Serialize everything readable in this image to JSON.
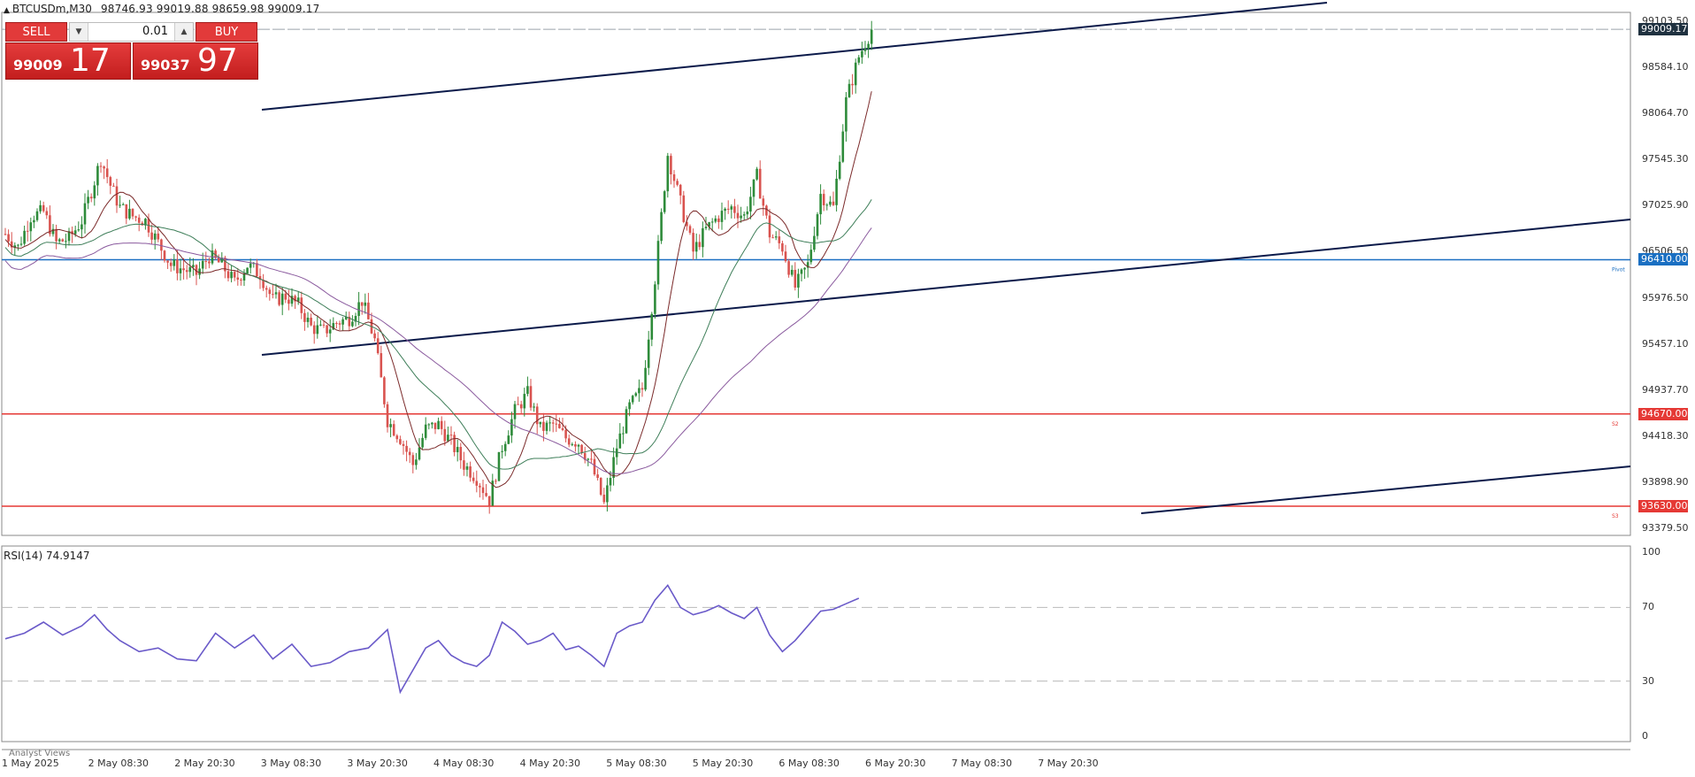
{
  "symbol": {
    "name": "BTCUSDm,M30",
    "ohlc": "98746.93 99019.88 98659.98 99009.17"
  },
  "trade_panel": {
    "sell_label": "SELL",
    "buy_label": "BUY",
    "lot": "0.01",
    "bid_main": "99009",
    "bid_big": "17",
    "ask_main": "99037",
    "ask_big": "97"
  },
  "price_axis": [
    "99103.50",
    "98584.10",
    "98064.70",
    "97545.30",
    "97025.90",
    "96506.50",
    "95976.50",
    "95457.10",
    "94937.70",
    "94418.30",
    "93898.90",
    "93379.50"
  ],
  "price_tags": {
    "current": "99009.17",
    "pivot": "96410.00",
    "s2": "94670.00",
    "s3": "93630.00"
  },
  "line_labels": {
    "pivot": "Pivot",
    "s2": "S2",
    "s3": "S3"
  },
  "rsi": {
    "label": "RSI(14) 74.9147",
    "levels": [
      "100",
      "70",
      "30",
      "0"
    ]
  },
  "time_axis": [
    "1 May 2025",
    "2 May 08:30",
    "2 May 20:30",
    "3 May 08:30",
    "3 May 20:30",
    "4 May 08:30",
    "4 May 20:30",
    "5 May 08:30",
    "5 May 20:30",
    "6 May 08:30",
    "6 May 20:30",
    "7 May 08:30",
    "7 May 20:30"
  ],
  "bottom_tab": "Analyst Views",
  "colors": {
    "bull": "#2e8b3a",
    "bear": "#d9534f",
    "pivot_line": "#1a6fc2",
    "support_line": "#e53935",
    "trend_line": "#0b1a4a",
    "rsi_line": "#6a5ac9",
    "ma_fast": "#7b2a2a",
    "ma_mid": "#3f7f5a",
    "ma_slow": "#8a5a9e"
  },
  "chart_data": {
    "type": "candlestick",
    "timeframe": "M30",
    "ylim": [
      93300,
      99200
    ],
    "rsi_levels": [
      70,
      30
    ],
    "key_levels": {
      "pivot": 96410.0,
      "s2": 94670.0,
      "s3": 93630.0,
      "last": 99009.17
    },
    "price_path": [
      [
        0,
        96700
      ],
      [
        4,
        96550
      ],
      [
        8,
        96900
      ],
      [
        12,
        96950
      ],
      [
        16,
        96600
      ],
      [
        20,
        96650
      ],
      [
        24,
        96850
      ],
      [
        28,
        97300
      ],
      [
        30,
        97550
      ],
      [
        33,
        97250
      ],
      [
        36,
        97000
      ],
      [
        40,
        96900
      ],
      [
        44,
        96850
      ],
      [
        48,
        96600
      ],
      [
        52,
        96350
      ],
      [
        56,
        96300
      ],
      [
        60,
        96250
      ],
      [
        64,
        96450
      ],
      [
        68,
        96350
      ],
      [
        72,
        96150
      ],
      [
        76,
        96350
      ],
      [
        80,
        96250
      ],
      [
        84,
        95950
      ],
      [
        88,
        96000
      ],
      [
        92,
        95900
      ],
      [
        96,
        95650
      ],
      [
        100,
        95600
      ],
      [
        104,
        95700
      ],
      [
        108,
        95750
      ],
      [
        112,
        95950
      ],
      [
        116,
        95500
      ],
      [
        120,
        94600
      ],
      [
        124,
        94400
      ],
      [
        128,
        94100
      ],
      [
        132,
        94500
      ],
      [
        136,
        94550
      ],
      [
        140,
        94350
      ],
      [
        144,
        94100
      ],
      [
        148,
        93950
      ],
      [
        152,
        93700
      ],
      [
        156,
        94300
      ],
      [
        160,
        94700
      ],
      [
        164,
        94900
      ],
      [
        168,
        94500
      ],
      [
        172,
        94550
      ],
      [
        176,
        94400
      ],
      [
        180,
        94350
      ],
      [
        184,
        94100
      ],
      [
        188,
        93650
      ],
      [
        192,
        94300
      ],
      [
        196,
        94750
      ],
      [
        200,
        94950
      ],
      [
        204,
        96200
      ],
      [
        208,
        97600
      ],
      [
        212,
        97050
      ],
      [
        216,
        96500
      ],
      [
        220,
        96750
      ],
      [
        224,
        96900
      ],
      [
        228,
        97000
      ],
      [
        232,
        96900
      ],
      [
        236,
        97350
      ],
      [
        240,
        96700
      ],
      [
        244,
        96550
      ],
      [
        248,
        96100
      ],
      [
        252,
        96350
      ],
      [
        256,
        97150
      ],
      [
        260,
        97000
      ],
      [
        264,
        98200
      ],
      [
        268,
        98700
      ],
      [
        272,
        99009
      ]
    ],
    "rsi_path": [
      [
        0,
        53
      ],
      [
        6,
        56
      ],
      [
        12,
        62
      ],
      [
        18,
        55
      ],
      [
        24,
        60
      ],
      [
        28,
        66
      ],
      [
        32,
        58
      ],
      [
        36,
        52
      ],
      [
        42,
        46
      ],
      [
        48,
        48
      ],
      [
        54,
        42
      ],
      [
        60,
        41
      ],
      [
        66,
        56
      ],
      [
        72,
        48
      ],
      [
        78,
        55
      ],
      [
        84,
        42
      ],
      [
        90,
        50
      ],
      [
        96,
        38
      ],
      [
        102,
        40
      ],
      [
        108,
        46
      ],
      [
        114,
        48
      ],
      [
        120,
        58
      ],
      [
        124,
        24
      ],
      [
        128,
        36
      ],
      [
        132,
        48
      ],
      [
        136,
        52
      ],
      [
        140,
        44
      ],
      [
        144,
        40
      ],
      [
        148,
        38
      ],
      [
        152,
        44
      ],
      [
        156,
        62
      ],
      [
        160,
        57
      ],
      [
        164,
        50
      ],
      [
        168,
        52
      ],
      [
        172,
        56
      ],
      [
        176,
        47
      ],
      [
        180,
        49
      ],
      [
        184,
        44
      ],
      [
        188,
        38
      ],
      [
        192,
        56
      ],
      [
        196,
        60
      ],
      [
        200,
        62
      ],
      [
        204,
        74
      ],
      [
        208,
        82
      ],
      [
        212,
        70
      ],
      [
        216,
        66
      ],
      [
        220,
        68
      ],
      [
        224,
        71
      ],
      [
        228,
        67
      ],
      [
        232,
        64
      ],
      [
        236,
        70
      ],
      [
        240,
        55
      ],
      [
        244,
        46
      ],
      [
        248,
        52
      ],
      [
        252,
        60
      ],
      [
        256,
        68
      ],
      [
        260,
        69
      ],
      [
        264,
        72
      ],
      [
        268,
        75
      ]
    ]
  }
}
